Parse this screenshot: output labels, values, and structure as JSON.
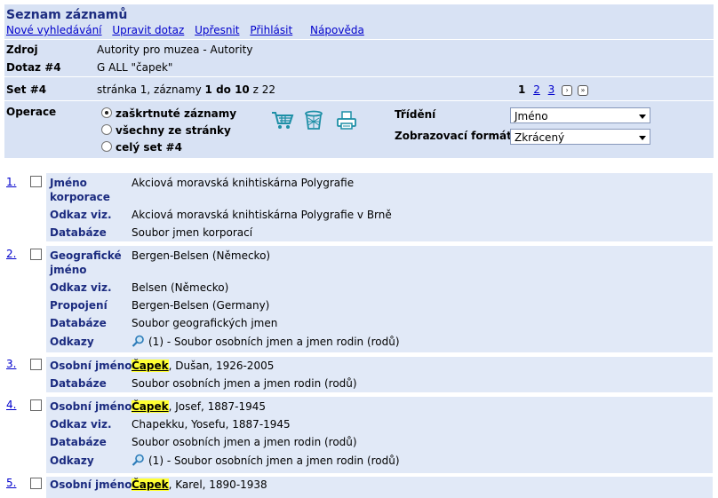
{
  "header": {
    "title": "Seznam záznamů",
    "links": [
      "Nové vyhledávání",
      "Upravit dotaz",
      "Upřesnit",
      "Přihlásit",
      "Nápověda"
    ]
  },
  "info": {
    "source_label": "Zdroj",
    "source_value": "Autority pro muzea - Autority",
    "query_label": "Dotaz #4",
    "query_value": "G ALL \"čapek\"",
    "set_label": "Set #4",
    "set_text_prefix": "stránka 1, záznamy ",
    "set_range": "1 do 10",
    "set_text_suffix": " z 22"
  },
  "pager": {
    "current": "1",
    "pages": [
      "2",
      "3"
    ],
    "next": "›",
    "last": "»"
  },
  "operations": {
    "label": "Operace",
    "options": [
      "zaškrtnuté záznamy",
      "všechny ze stránky",
      "celý set #4"
    ],
    "selected_index": 0,
    "icons": [
      "cart-icon",
      "trash-icon",
      "print-icon"
    ],
    "sort_label": "Třídění",
    "sort_value": "Jméno",
    "format_label": "Zobrazovací formát",
    "format_value": "Zkrácený"
  },
  "results": [
    {
      "num": "1.",
      "fields": [
        {
          "label": "Jméno korporace",
          "value": "Akciová moravská knihtiskárna Polygrafie"
        },
        {
          "label": "Odkaz viz.",
          "value": "Akciová moravská knihtiskárna Polygrafie v Brně"
        },
        {
          "label": "Databáze",
          "value": "Soubor jmen korporací"
        }
      ]
    },
    {
      "num": "2.",
      "fields": [
        {
          "label": "Geografické jméno",
          "value": "Bergen-Belsen (Německo)"
        },
        {
          "label": "Odkaz viz.",
          "value": "Belsen (Německo)"
        },
        {
          "label": "Propojení",
          "value": "Bergen-Belsen (Germany)"
        },
        {
          "label": "Databáze",
          "value": "Soubor geografických jmen"
        },
        {
          "label": "Odkazy",
          "value": "(1) - Soubor osobních jmen a jmen rodin (rodů)"
        }
      ]
    },
    {
      "num": "3.",
      "fields": [
        {
          "label": "Osobní jméno",
          "highlight": "Čapek",
          "value": ", Dušan, 1926-2005"
        },
        {
          "label": "Databáze",
          "value": "Soubor osobních jmen a jmen rodin (rodů)"
        }
      ]
    },
    {
      "num": "4.",
      "fields": [
        {
          "label": "Osobní jméno",
          "highlight": "Čapek",
          "value": ", Josef, 1887-1945"
        },
        {
          "label": "Odkaz viz.",
          "value": "Chapekku, Yosefu, 1887-1945"
        },
        {
          "label": "Databáze",
          "value": "Soubor osobních jmen a jmen rodin (rodů)"
        },
        {
          "label": "Odkazy",
          "value": "(1) - Soubor osobních jmen a jmen rodin (rodů)"
        }
      ]
    },
    {
      "num": "5.",
      "fields": [
        {
          "label": "Osobní jméno",
          "highlight": "Čapek",
          "value": ", Karel, 1890-1938"
        }
      ]
    }
  ]
}
